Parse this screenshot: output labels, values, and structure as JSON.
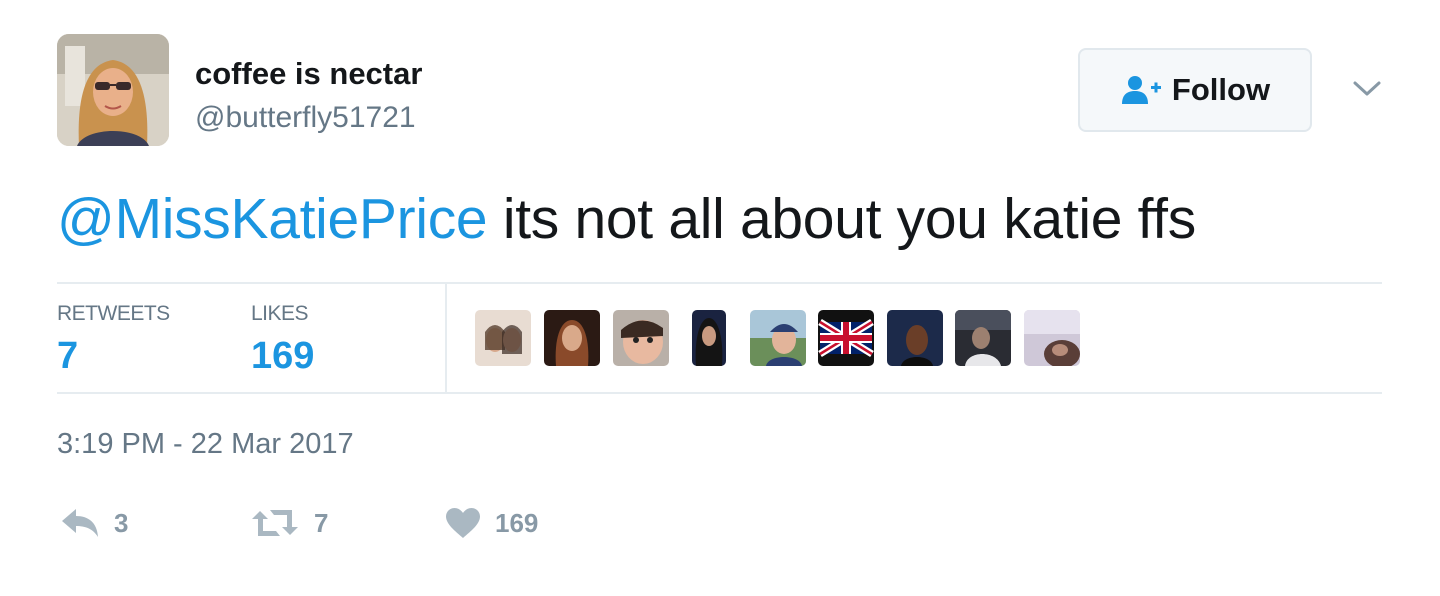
{
  "author": {
    "display_name": "coffee is nectar",
    "handle": "@butterfly51721",
    "avatar_icon": "user-avatar-photo"
  },
  "follow_button": {
    "label": "Follow",
    "icon": "add-user-icon"
  },
  "tweet": {
    "mention": "@MissKatiePrice",
    "text": " its not all about you katie ffs"
  },
  "stats": {
    "retweets_label": "RETWEETS",
    "retweets_value": "7",
    "likes_label": "LIKES",
    "likes_value": "169",
    "liker_avatars": [
      "liker-avatar-1",
      "liker-avatar-2",
      "liker-avatar-3",
      "liker-avatar-4",
      "liker-avatar-5",
      "liker-avatar-uk-flag",
      "liker-avatar-7",
      "liker-avatar-8",
      "liker-avatar-9"
    ]
  },
  "timestamp": "3:19 PM - 22 Mar 2017",
  "actions": {
    "reply_count": "3",
    "retweet_count": "7",
    "like_count": "169"
  },
  "colors": {
    "accent": "#1b95e0",
    "muted": "#657786",
    "action_icon": "#aab8c2",
    "text": "#14171a"
  }
}
